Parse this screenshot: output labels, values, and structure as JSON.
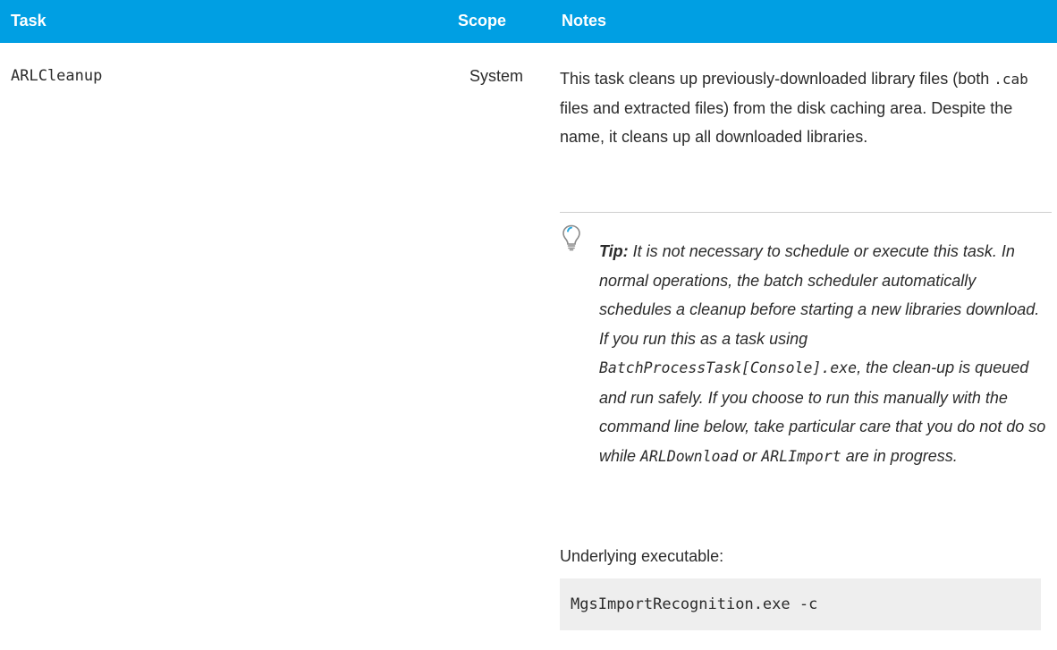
{
  "table": {
    "headers": {
      "task": "Task",
      "scope": "Scope",
      "notes": "Notes"
    },
    "row": {
      "task": "ARLCleanup",
      "scope": "System",
      "notes": {
        "p1_a": "This task cleans up previously-downloaded library files (both ",
        "p1_code": ".cab",
        "p1_b": " files and extracted files) from the disk caching area. Despite the name, it cleans up all downloaded libraries.",
        "tip": {
          "label": "Tip:",
          "a": " It is not necessary to schedule or execute this task. In normal operations, the batch scheduler automatically schedules a cleanup before starting a new libraries download. If you run this as a task using ",
          "code1": "BatchProcessTask[Console].exe",
          "b": ", the clean-up is queued and run safely. If you choose to run this manually with the command line below, take particular care that you do not do so while ",
          "code2": "ARLDownload",
          "c": " or ",
          "code3": "ARLImport",
          "d": " are in progress.",
          "icon": "lightbulb-icon"
        },
        "executable_label": "Underlying executable:",
        "command": "MgsImportRecognition.exe -c"
      }
    }
  },
  "colors": {
    "header_bg": "#009fe3",
    "header_text": "#ffffff",
    "code_bg": "#eeeeee",
    "tip_icon_accent": "#29a9e0"
  }
}
